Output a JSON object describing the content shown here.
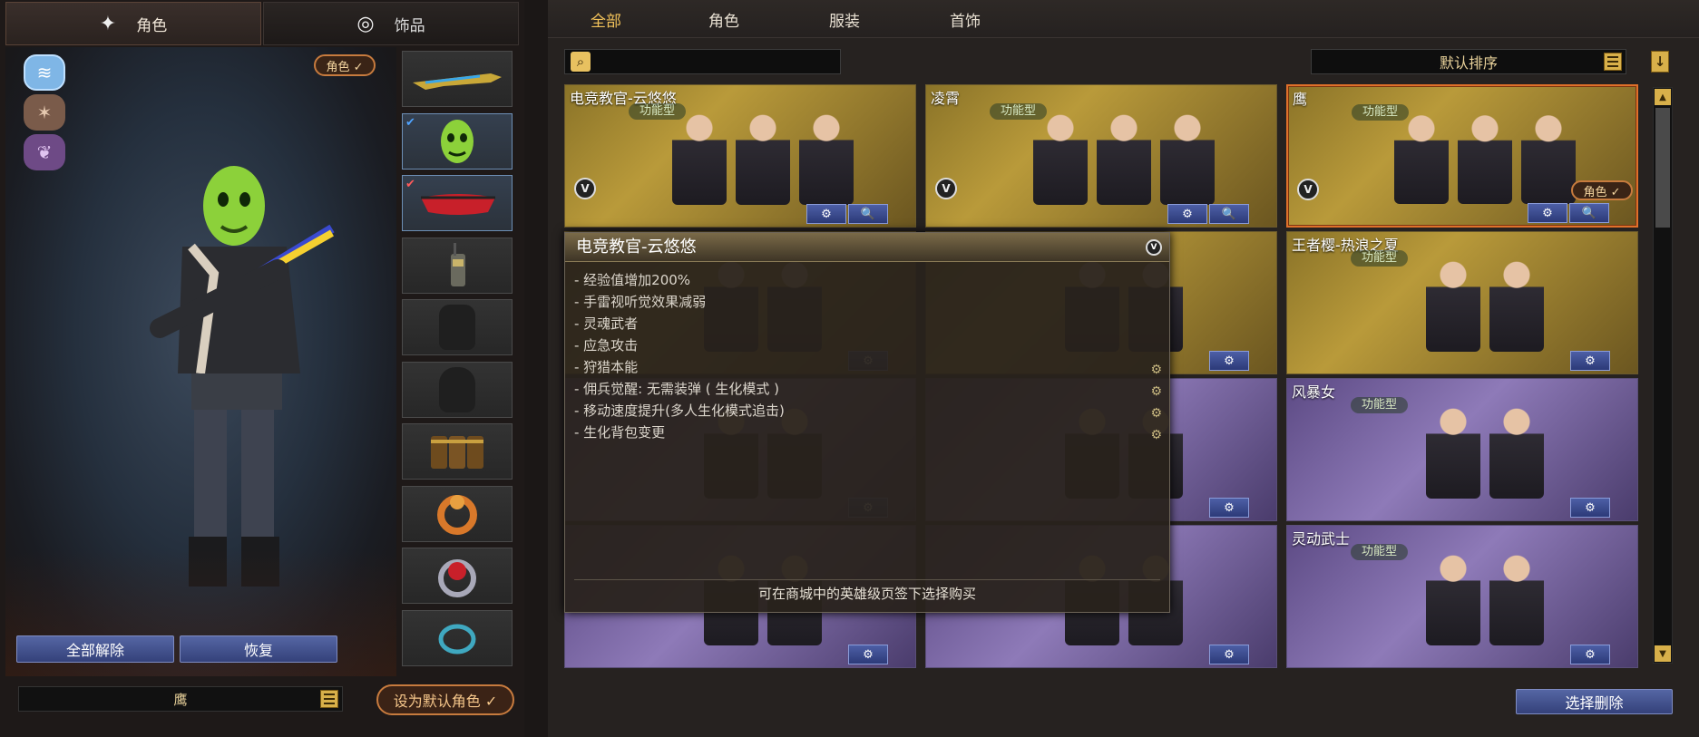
{
  "left": {
    "tabs": [
      {
        "label": "角色",
        "icon": "character-sparkle-icon",
        "active": true
      },
      {
        "label": "饰品",
        "icon": "ring-icon",
        "active": false
      }
    ],
    "role_chip": "角色 ✓",
    "side_icons": [
      "wing-badge-icon",
      "eagle-badge-icon",
      "bird-badge-icon"
    ],
    "slots": [
      {
        "icon": "shotgun-icon",
        "selected": false
      },
      {
        "icon": "green-mask-icon",
        "selected": true
      },
      {
        "icon": "red-goggles-icon",
        "selected": true
      },
      {
        "icon": "radio-icon",
        "selected": false
      },
      {
        "icon": "backpack-silhouette-icon",
        "selected": false
      },
      {
        "icon": "vest-silhouette-icon",
        "selected": false
      },
      {
        "icon": "ammo-pouch-icon",
        "selected": false
      },
      {
        "icon": "dragon-ring-icon",
        "selected": false
      },
      {
        "icon": "ruby-ring-icon",
        "selected": false
      },
      {
        "icon": "bracelet-icon",
        "selected": false
      }
    ],
    "buttons": {
      "remove_all": "全部解除",
      "restore": "恢复"
    },
    "name_value": "鹰",
    "set_default": "设为默认角色 ✓"
  },
  "right": {
    "categories": [
      {
        "label": "全部",
        "active": true
      },
      {
        "label": "角色",
        "active": false
      },
      {
        "label": "服装",
        "active": false
      },
      {
        "label": "首饰",
        "active": false
      }
    ],
    "search": {
      "placeholder": "",
      "icon": "search-icon"
    },
    "sort": {
      "label": "默认排序"
    },
    "cards": [
      {
        "title": "电竞教官-云悠悠",
        "type": "功能型",
        "color": "gold",
        "figures": 3,
        "vbadge": "V",
        "buttons": [
          "⚙",
          "🔍"
        ]
      },
      {
        "title": "凌霄",
        "type": "功能型",
        "color": "gold",
        "figures": 3,
        "vbadge": "V",
        "buttons": [
          "⚙",
          "🔍"
        ]
      },
      {
        "title": "鹰",
        "type": "功能型",
        "color": "gold",
        "figures": 3,
        "vbadge": "V",
        "buttons": [
          "⚙",
          "🔍"
        ],
        "selected": true,
        "role_chip": "角色 ✓"
      },
      {
        "title": "",
        "type": "",
        "color": "gold",
        "figures": 2,
        "buttons": [
          "⚙"
        ]
      },
      {
        "title": "",
        "type": "",
        "color": "gold",
        "figures": 2,
        "buttons": [
          "⚙"
        ]
      },
      {
        "title": "王者樱-热浪之夏",
        "type": "功能型",
        "color": "gold",
        "figures": 2,
        "buttons": [
          "⚙"
        ]
      },
      {
        "title": "",
        "type": "",
        "color": "purple",
        "figures": 2,
        "buttons": [
          "⚙"
        ]
      },
      {
        "title": "",
        "type": "",
        "color": "purple",
        "figures": 2,
        "buttons": [
          "⚙"
        ]
      },
      {
        "title": "风暴女",
        "type": "功能型",
        "color": "purple",
        "figures": 2,
        "buttons": [
          "⚙"
        ]
      },
      {
        "title": "",
        "type": "",
        "color": "purple",
        "figures": 2,
        "buttons": [
          "⚙"
        ]
      },
      {
        "title": "",
        "type": "",
        "color": "purple",
        "figures": 2,
        "buttons": [
          "⚙"
        ]
      },
      {
        "title": "灵动武士",
        "type": "功能型",
        "color": "purple",
        "figures": 2,
        "buttons": [
          "⚙"
        ]
      }
    ],
    "tooltip": {
      "title": "电竞教官-云悠悠",
      "vbadge": "V",
      "features": [
        {
          "text": "- 经验值增加200%",
          "gear": false
        },
        {
          "text": "- 手雷视听觉效果减弱",
          "gear": false
        },
        {
          "text": "- 灵魂武者",
          "gear": false
        },
        {
          "text": "- 应急攻击",
          "gear": false
        },
        {
          "text": "- 狩猎本能",
          "gear": true
        },
        {
          "text": "- 佣兵觉醒: 无需装弹 ( 生化模式 )",
          "gear": true
        },
        {
          "text": "- 移动速度提升(多人生化模式追击)",
          "gear": true
        },
        {
          "text": "- 生化背包变更",
          "gear": true
        }
      ],
      "footer": "可在商城中的英雄级页签下选择购买"
    },
    "delete_button": "选择删除"
  },
  "colors": {
    "accent_gold": "#f2c25a",
    "role_orange": "#c77b3e",
    "button_blue": "#34417a"
  }
}
